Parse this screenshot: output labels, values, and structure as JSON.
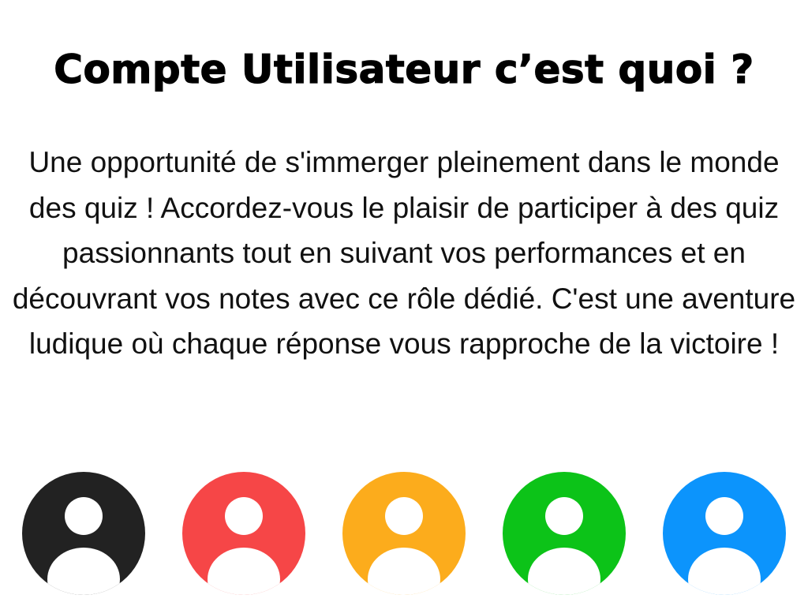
{
  "header": {
    "title": "Compte Utilisateur c’est quoi ?"
  },
  "main": {
    "description": "Une opportunité de s'immerger pleinement dans le monde des quiz ! Accordez-vous le plaisir de participer à des quiz passionnants tout en suivant vos performances et en découvrant vos notes avec ce rôle dédié. C'est une aventure ludique où chaque réponse vous rapproche de la victoire !"
  },
  "avatars": [
    {
      "icon": "user-avatar-icon",
      "color": "#222222"
    },
    {
      "icon": "user-avatar-icon",
      "color": "#f64647"
    },
    {
      "icon": "user-avatar-icon",
      "color": "#fcac1c"
    },
    {
      "icon": "user-avatar-icon",
      "color": "#0cc318"
    },
    {
      "icon": "user-avatar-icon",
      "color": "#0c94fc"
    }
  ]
}
